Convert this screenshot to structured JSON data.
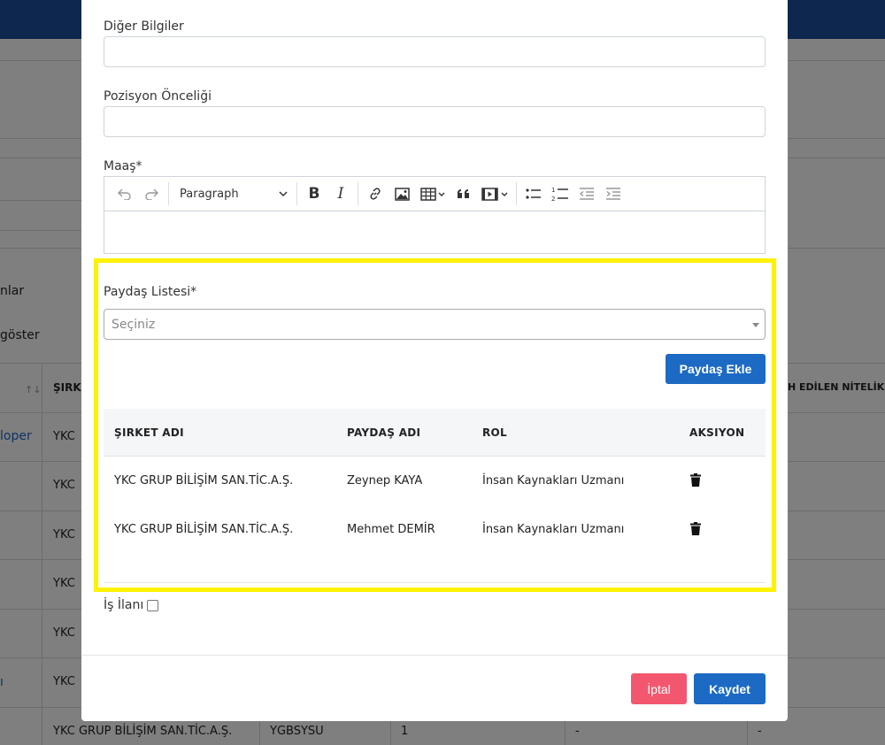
{
  "background": {
    "partial_labels": [
      "nlar",
      "göster"
    ],
    "table_header_partials": [
      "ŞIRKE",
      "H EDİLEN NİTELİKL"
    ],
    "sort_icon": "↑↓",
    "link_partials": [
      "loper",
      "ı"
    ],
    "cell_prefix": "YKC",
    "last_row": [
      "YKC GRUP BİLİŞİM SAN.TİC.A.Ş.",
      "YGBSYSU",
      "1",
      "-",
      "-"
    ]
  },
  "modal": {
    "fields": {
      "diger_bilgiler_label": "Diğer Bilgiler",
      "diger_bilgiler_value": "",
      "pozisyon_label": "Pozisyon Önceliği",
      "pozisyon_value": "",
      "maas_label": "Maaş*"
    },
    "editor": {
      "paragraph_select": "Paragraph",
      "tools": [
        "undo-icon",
        "redo-icon",
        "bold-icon",
        "italic-icon",
        "link-icon",
        "image-icon",
        "table-icon",
        "quote-icon",
        "media-icon",
        "bulleted-list-icon",
        "numbered-list-icon",
        "outdent-icon",
        "indent-icon"
      ],
      "bold_glyph": "B",
      "italic_glyph": "I",
      "content": ""
    },
    "paydas": {
      "label": "Paydaş Listesi*",
      "placeholder": "Seçiniz",
      "add_button": "Paydaş Ekle",
      "highlight_color": "#fff200",
      "table": {
        "columns": [
          "ŞIRKET ADI",
          "PAYDAŞ ADI",
          "ROL",
          "AKSIYON"
        ],
        "rows": [
          [
            "YKC GRUP BİLİŞİM SAN.TİC.A.Ş.",
            "Zeynep KAYA",
            "İnsan Kaynakları Uzmanı",
            "trash-icon"
          ],
          [
            "YKC GRUP BİLİŞİM SAN.TİC.A.Ş.",
            "Mehmet DEMİR",
            "İnsan Kaynakları Uzmanı",
            "trash-icon"
          ]
        ]
      }
    },
    "is_ilani": {
      "label": "İş İlanı",
      "checked": false
    },
    "footer": {
      "cancel": "İptal",
      "save": "Kaydet"
    },
    "colors": {
      "primary": "#1c6ac3",
      "danger": "#f2576f",
      "header_blue": "#1c4f9c"
    }
  }
}
